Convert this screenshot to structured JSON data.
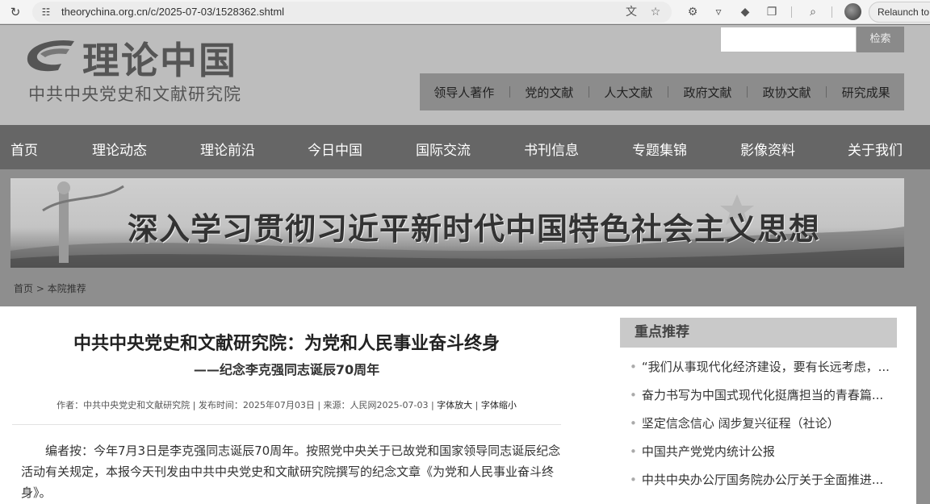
{
  "browser": {
    "url": "theorychina.org.cn/c/2025-07-03/1528362.shtml",
    "relaunch_label": "Relaunch to u"
  },
  "header": {
    "logo_title": "理论中国",
    "logo_subtitle": "中共中央党史和文献研究院",
    "search_placeholder": "",
    "search_button": "检索",
    "quick_links": [
      "领导人著作",
      "党的文献",
      "人大文献",
      "政府文献",
      "政协文献",
      "研究成果"
    ]
  },
  "nav": {
    "items": [
      "首页",
      "理论动态",
      "理论前沿",
      "今日中国",
      "国际交流",
      "书刊信息",
      "专题集锦",
      "影像资料",
      "关于我们"
    ]
  },
  "banner": {
    "text": "深入学习贯彻习近平新时代中国特色社会主义思想"
  },
  "breadcrumb": {
    "home": "首页",
    "separator": ">",
    "current": "本院推荐"
  },
  "article": {
    "title": "中共中央党史和文献研究院：为党和人民事业奋斗终身",
    "subtitle": "——纪念李克强同志诞辰70周年",
    "meta_author": "作者：中共中央党史和文献研究院",
    "meta_date": "发布时间：2025年07月03日",
    "meta_source": "来源：人民网2025-07-03",
    "font_larger": "字体放大",
    "font_smaller": "字体缩小",
    "editor_note": "编者按：今年7月3日是李克强同志诞辰70周年。按照党中央关于已故党和国家领导同志诞辰纪念活动有关规定，本报今天刊发由中共中央党史和文献研究院撰写的纪念文章《为党和人民事业奋斗终身》。"
  },
  "sidebar": {
    "heading": "重点推荐",
    "items": [
      "“我们从事现代化经济建设，要有长远考虑，...",
      "奋力书写为中国式现代化挺膺担当的青春篇...",
      "坚定信念信心 阔步复兴征程（社论）",
      "中国共产党党内统计公报",
      "中共中央办公厅国务院办公厅关于全面推进..."
    ]
  }
}
